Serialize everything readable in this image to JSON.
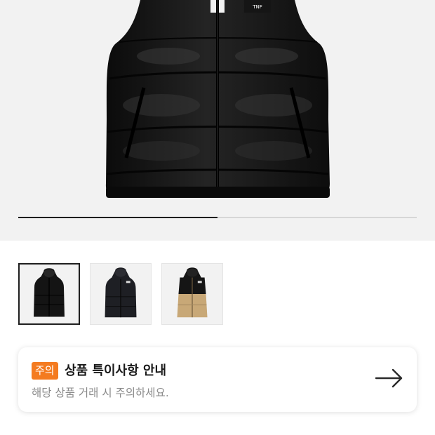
{
  "product_gallery": {
    "main_image": "black-puffer-vest",
    "progress": 0.5
  },
  "thumbnails": [
    {
      "image": "black-puffer-vest-front",
      "selected": true
    },
    {
      "image": "black-puffer-vest-worn",
      "selected": false
    },
    {
      "image": "beige-puffer-vest",
      "selected": false
    }
  ],
  "notice": {
    "badge": "주의",
    "title": "상품 특이사항 안내",
    "subtitle": "해당 상품 거래 시 주의하세요.",
    "arrow_icon": "arrow-right-icon"
  },
  "colors": {
    "badge": "#f47b20",
    "hero_background": "#f2f2f2"
  }
}
